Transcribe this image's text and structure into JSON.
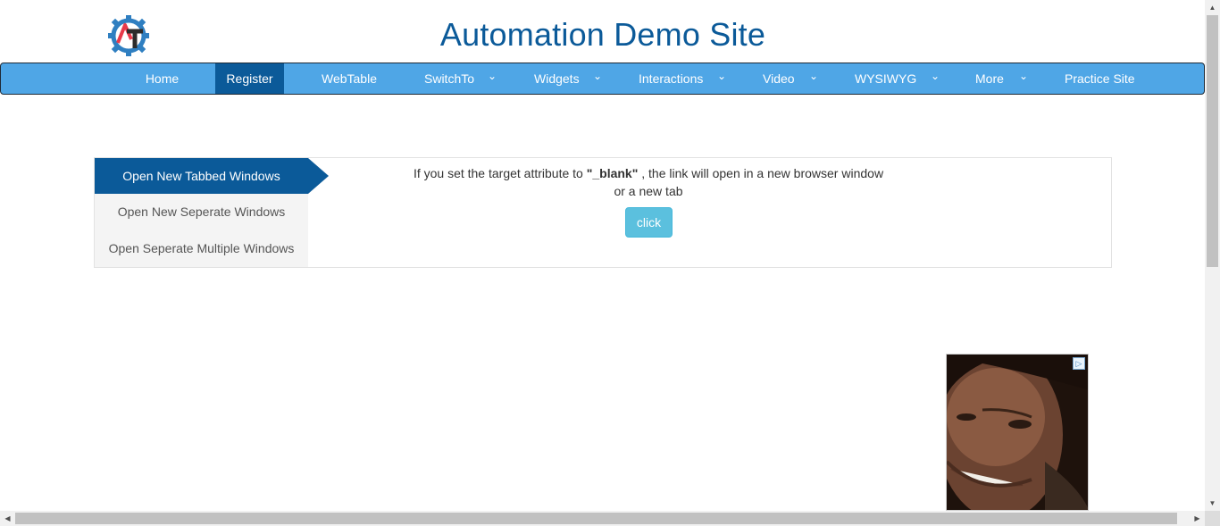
{
  "header": {
    "title": "Automation Demo Site",
    "logo_icon": "automation-testing-gear-logo"
  },
  "nav": {
    "items": [
      {
        "label": "Home",
        "dropdown": false,
        "active": false
      },
      {
        "label": "Register",
        "dropdown": false,
        "active": true
      },
      {
        "label": "WebTable",
        "dropdown": false,
        "active": false
      },
      {
        "label": "SwitchTo",
        "dropdown": true,
        "active": false
      },
      {
        "label": "Widgets",
        "dropdown": true,
        "active": false
      },
      {
        "label": "Interactions",
        "dropdown": true,
        "active": false
      },
      {
        "label": "Video",
        "dropdown": true,
        "active": false
      },
      {
        "label": "WYSIWYG",
        "dropdown": true,
        "active": false
      },
      {
        "label": "More",
        "dropdown": true,
        "active": false
      },
      {
        "label": "Practice Site",
        "dropdown": false,
        "active": false
      }
    ],
    "chevron_glyph": "⌄"
  },
  "tabs": {
    "items": [
      {
        "label": "Open New Tabbed Windows",
        "active": true
      },
      {
        "label": "Open New Seperate Windows",
        "active": false
      },
      {
        "label": "Open Seperate Multiple Windows",
        "active": false
      }
    ]
  },
  "content": {
    "text_before": "If you set the target attribute to ",
    "text_bold": "\"_blank\"",
    "text_after": " , the link will open in a new browser window",
    "text_line2": "or a new tab",
    "button_label": "click"
  },
  "ad": {
    "badge_icon": "adchoices-icon",
    "badge_glyph": "▷"
  },
  "scrollbars": {
    "up_glyph": "▲",
    "down_glyph": "▼",
    "left_glyph": "◀",
    "right_glyph": "▶"
  },
  "colors": {
    "title": "#0b5a99",
    "nav_bg": "#4fa6e6",
    "nav_active": "#0b5a99",
    "tab_active": "#0b5a99",
    "button": "#5bc0de"
  }
}
